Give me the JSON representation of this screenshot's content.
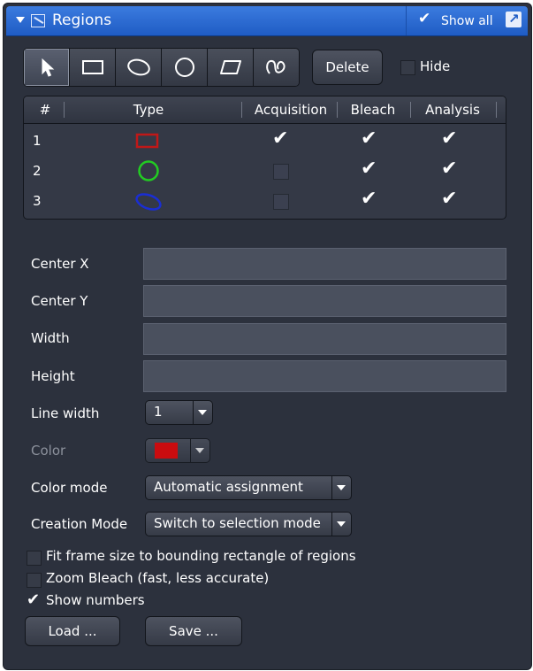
{
  "header": {
    "title": "Regions",
    "show_all_label": "Show all",
    "show_all_checked": true
  },
  "tools": [
    {
      "name": "pointer-tool",
      "active": true
    },
    {
      "name": "rectangle-tool",
      "active": false
    },
    {
      "name": "ellipse-tool",
      "active": false
    },
    {
      "name": "circle-tool",
      "active": false
    },
    {
      "name": "polygon-tool",
      "active": false
    },
    {
      "name": "freehand-tool",
      "active": false
    }
  ],
  "actions": {
    "delete_label": "Delete",
    "hide_label": "Hide",
    "hide_checked": false
  },
  "table": {
    "columns": [
      "#",
      "Type",
      "Acquisition",
      "Bleach",
      "Analysis"
    ],
    "rows": [
      {
        "num": "1",
        "type": "rectangle",
        "type_color": "#c01818",
        "acquisition": true,
        "bleach": true,
        "analysis": true
      },
      {
        "num": "2",
        "type": "circle",
        "type_color": "#22cc22",
        "acquisition": false,
        "bleach": true,
        "analysis": true
      },
      {
        "num": "3",
        "type": "ellipse",
        "type_color": "#1a2ed4",
        "acquisition": false,
        "bleach": true,
        "analysis": true
      }
    ]
  },
  "fields": {
    "center_x_label": "Center X",
    "center_x_value": "",
    "center_y_label": "Center Y",
    "center_y_value": "",
    "width_label": "Width",
    "width_value": "",
    "height_label": "Height",
    "height_value": ""
  },
  "line_width": {
    "label": "Line width",
    "value": "1"
  },
  "color": {
    "label": "Color",
    "value": "#ff0000"
  },
  "color_mode": {
    "label": "Color mode",
    "value": "Automatic assignment"
  },
  "creation_mode": {
    "label": "Creation Mode",
    "value": "Switch to selection mode"
  },
  "options": {
    "fit_frame_label": "Fit frame size to bounding rectangle of regions",
    "fit_frame_checked": false,
    "zoom_bleach_label": "Zoom Bleach (fast, less accurate)",
    "zoom_bleach_checked": false,
    "show_numbers_label": "Show numbers",
    "show_numbers_checked": true
  },
  "buttons": {
    "load_label": "Load ...",
    "save_label": "Save ..."
  },
  "colors": {
    "panel_bg": "#2c313d",
    "header_blue": "#1f5cc4"
  }
}
